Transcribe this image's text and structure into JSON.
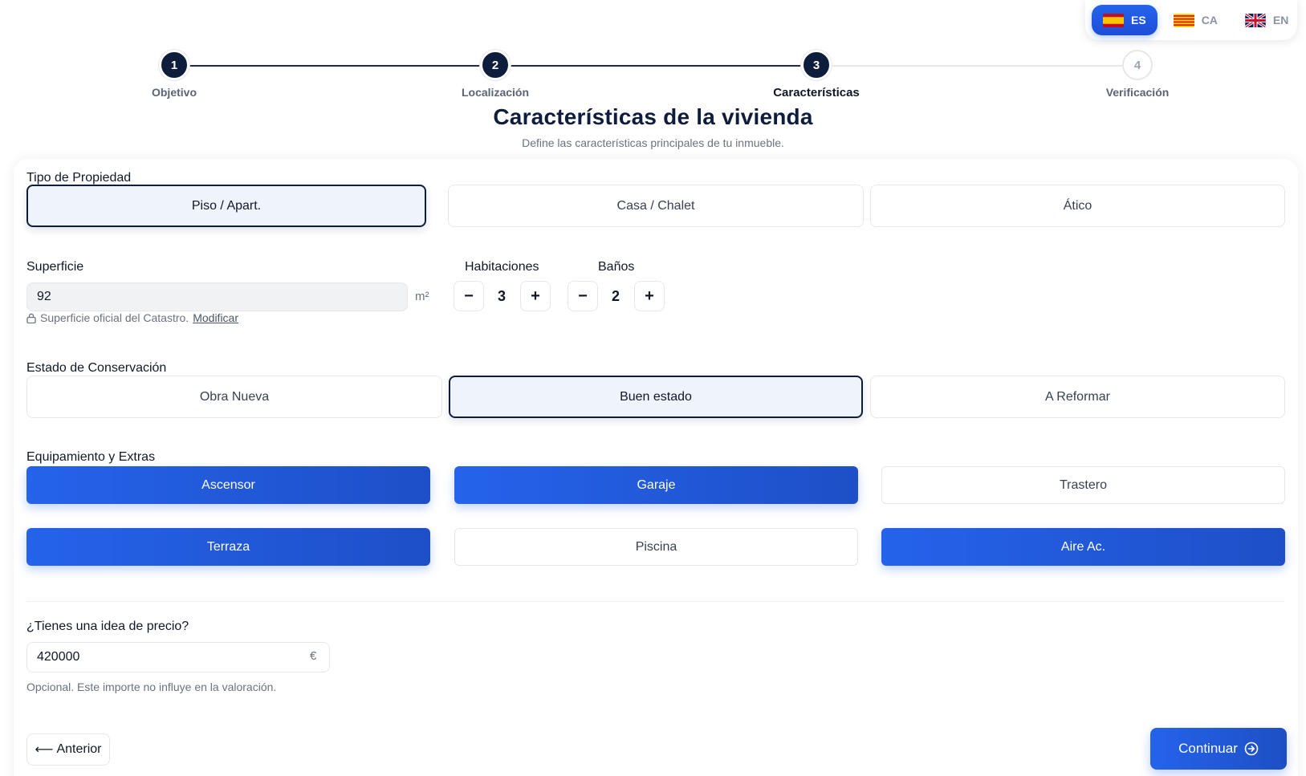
{
  "languages": [
    {
      "code": "ES",
      "flag": "spain-flag-icon",
      "active": true
    },
    {
      "code": "CA",
      "flag": "catalonia-flag-icon",
      "active": false
    },
    {
      "code": "EN",
      "flag": "uk-flag-icon",
      "active": false
    }
  ],
  "stepper": {
    "steps": [
      {
        "number": "1",
        "label": "Objetivo",
        "state": "done"
      },
      {
        "number": "2",
        "label": "Localización",
        "state": "done"
      },
      {
        "number": "3",
        "label": "Características",
        "state": "current"
      },
      {
        "number": "4",
        "label": "Verificación",
        "state": "future"
      }
    ]
  },
  "header": {
    "title": "Características de la vivienda",
    "subtitle": "Define las características principales de tu inmueble."
  },
  "property_type": {
    "label": "Tipo de Propiedad",
    "options": [
      "Piso / Apart.",
      "Casa / Chalet",
      "Ático"
    ],
    "selected": "Piso / Apart."
  },
  "surface": {
    "label": "Superficie",
    "value": "92",
    "unit": "m²",
    "note_text": "Superficie oficial del Catastro.",
    "note_link": "Modificar"
  },
  "rooms": {
    "label": "Habitaciones",
    "value": "3",
    "minus": "−",
    "plus": "+"
  },
  "baths": {
    "label": "Baños",
    "value": "2",
    "minus": "−",
    "plus": "+"
  },
  "condition": {
    "label": "Estado de Conservación",
    "options": [
      "Obra Nueva",
      "Buen estado",
      "A Reformar"
    ],
    "selected": "Buen estado"
  },
  "extras": {
    "label": "Equipamiento y Extras",
    "items": [
      {
        "label": "Ascensor",
        "on": true
      },
      {
        "label": "Garaje",
        "on": true
      },
      {
        "label": "Trastero",
        "on": false
      },
      {
        "label": "Terraza",
        "on": true
      },
      {
        "label": "Piscina",
        "on": false
      },
      {
        "label": "Aire Ac.",
        "on": true
      }
    ]
  },
  "price": {
    "label": "¿Tienes una idea de precio?",
    "value": "420000",
    "currency": "€",
    "note": "Opcional. Este importe no influye en la valoración."
  },
  "nav": {
    "back_arrow": "⟵",
    "back_label": "Anterior",
    "next_label": "Continuar"
  },
  "colors": {
    "primary": "#2563eb",
    "navy": "#0f1d3d",
    "selected_bg": "#eef3fc"
  }
}
